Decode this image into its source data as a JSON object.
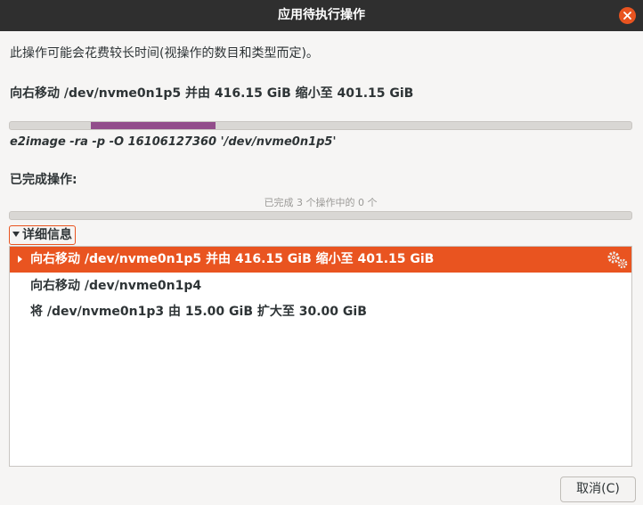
{
  "window": {
    "title": "应用待执行操作"
  },
  "description": "此操作可能会花费较长时间(视操作的数目和类型而定)。",
  "current_operation": {
    "text": "向右移动 /dev/nvme0n1p5 并由 416.15 GiB 缩小至 401.15 GiB",
    "progress_segment": {
      "start": 0.13,
      "end": 0.33
    },
    "command": "e2image -ra -p -O 16106127360 '/dev/nvme0n1p5'"
  },
  "completed": {
    "label": "已完成操作:",
    "count_text": "已完成 3 个操作中的 0 个",
    "progress": 0
  },
  "details": {
    "expander_label": "详细信息",
    "operations": [
      {
        "text": "向右移动 /dev/nvme0n1p5 并由 416.15 GiB 缩小至 401.15 GiB",
        "selected": true,
        "icon": "gears-icon"
      },
      {
        "text": "向右移动 /dev/nvme0n1p4",
        "selected": false
      },
      {
        "text": "将 /dev/nvme0n1p3 由 15.00 GiB 扩大至 30.00 GiB",
        "selected": false
      }
    ]
  },
  "buttons": {
    "cancel_label": "取消(C)"
  },
  "colors": {
    "accent": "#e95420",
    "progress_fill": "#924d8b",
    "titlebar": "#2f2f2f"
  }
}
